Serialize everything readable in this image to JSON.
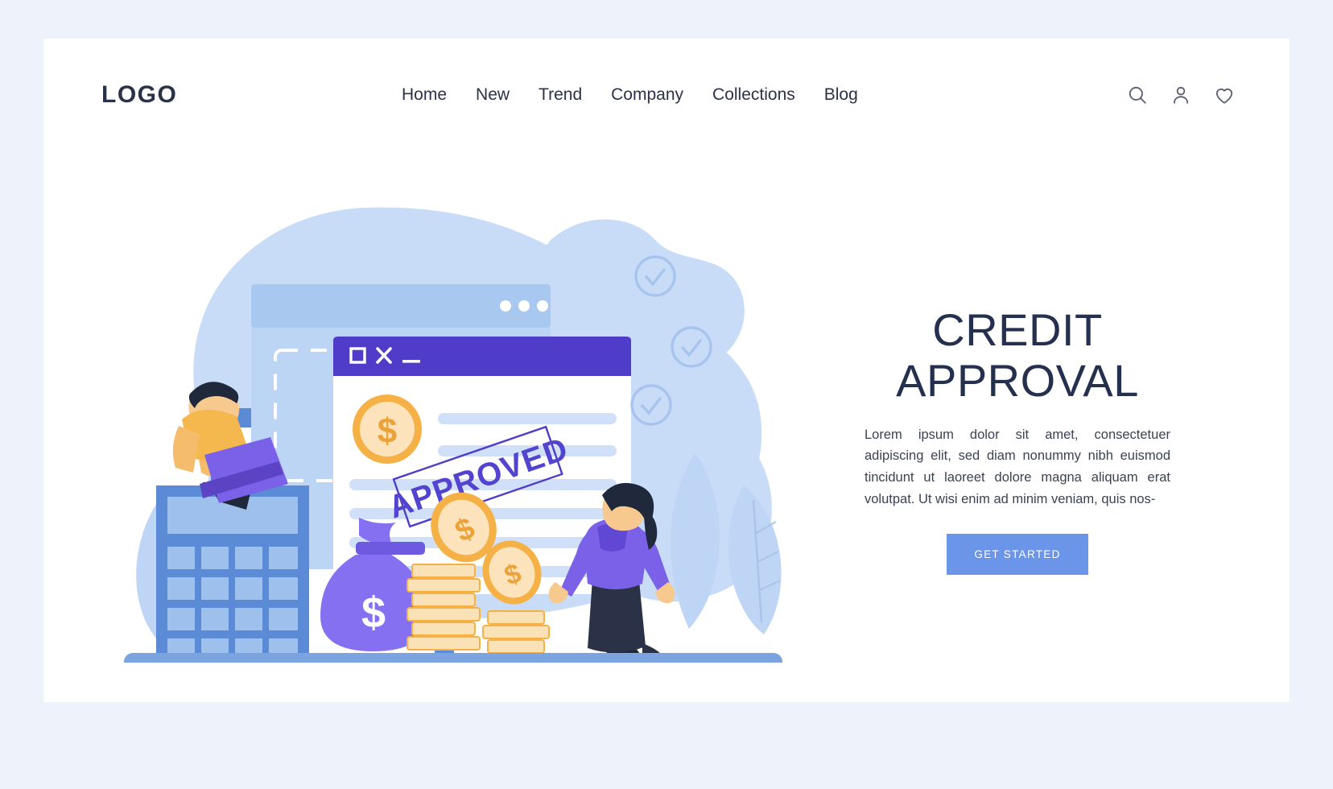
{
  "site": {
    "logo": "LOGO"
  },
  "nav": {
    "items": [
      {
        "label": "Home"
      },
      {
        "label": "New"
      },
      {
        "label": "Trend"
      },
      {
        "label": "Company"
      },
      {
        "label": "Collections"
      },
      {
        "label": "Blog"
      }
    ],
    "icons": [
      {
        "name": "search-icon"
      },
      {
        "name": "user-icon"
      },
      {
        "name": "heart-icon"
      }
    ]
  },
  "hero": {
    "title_line1": "CREDIT",
    "title_line2": "APPROVAL",
    "paragraph": "Lorem ipsum dolor sit amet, consectetuer adipiscing elit, sed diam nonummy nibh euismod tincidunt ut laoreet dolore magna aliquam erat volutpat. Ut wisi enim ad minim veniam, quis nos-",
    "cta_label": "GET STARTED"
  },
  "illustration": {
    "window_title_icons": [
      "square",
      "x",
      "minus"
    ],
    "stamp_text": "APPROVED",
    "money_bag_symbol": "$",
    "coin_symbol": "$",
    "check_badges": 3
  },
  "colors": {
    "page_background": "#eef2fb",
    "card_background": "#ffffff",
    "text_dark": "#2b3247",
    "headline": "#24304e",
    "accent_purple": "#4f3cc9",
    "accent_blue": "#6a95e8",
    "light_blue": "#c5daf6",
    "gold": "#f5b046"
  }
}
